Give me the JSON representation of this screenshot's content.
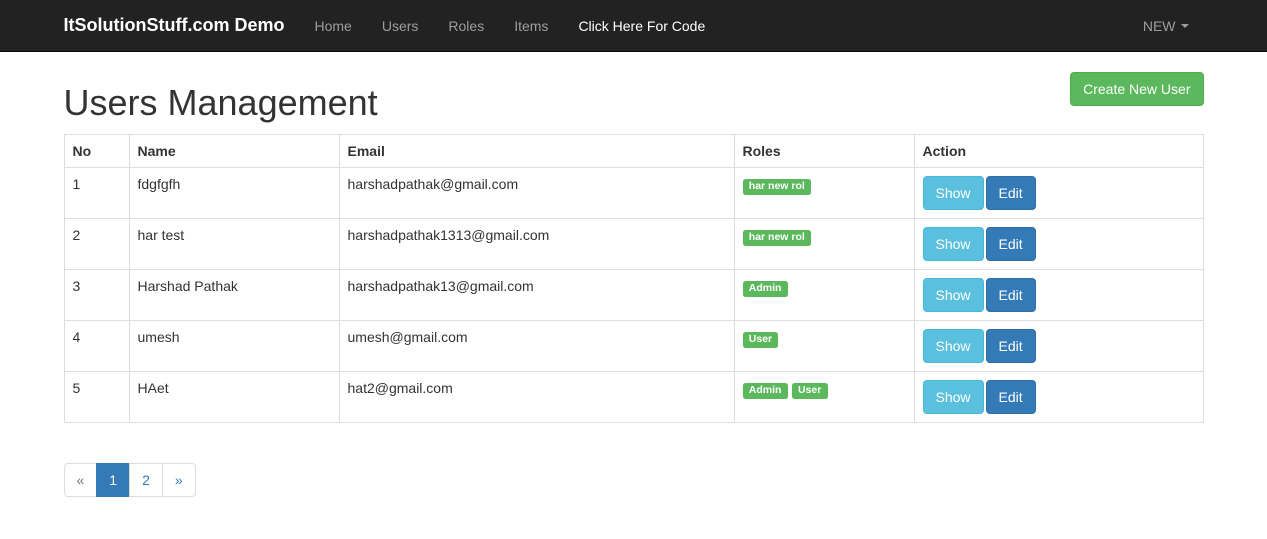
{
  "navbar": {
    "brand": "ItSolutionStuff.com Demo",
    "links": [
      {
        "label": "Home",
        "active": false
      },
      {
        "label": "Users",
        "active": false
      },
      {
        "label": "Roles",
        "active": false
      },
      {
        "label": "Items",
        "active": false
      },
      {
        "label": "Click Here For Code",
        "active": true
      }
    ],
    "right_label": "NEW"
  },
  "page": {
    "title": "Users Management",
    "create_button": "Create New User"
  },
  "table": {
    "headers": {
      "no": "No",
      "name": "Name",
      "email": "Email",
      "roles": "Roles",
      "action": "Action"
    },
    "rows": [
      {
        "no": "1",
        "name": "fdgfgfh",
        "email": "harshadpathak@gmail.com",
        "roles": [
          "har new rol"
        ]
      },
      {
        "no": "2",
        "name": "har test",
        "email": "harshadpathak1313@gmail.com",
        "roles": [
          "har new rol"
        ]
      },
      {
        "no": "3",
        "name": "Harshad Pathak",
        "email": "harshadpathak13@gmail.com",
        "roles": [
          "Admin"
        ]
      },
      {
        "no": "4",
        "name": "umesh",
        "email": "umesh@gmail.com",
        "roles": [
          "User"
        ]
      },
      {
        "no": "5",
        "name": "HAet",
        "email": "hat2@gmail.com",
        "roles": [
          "Admin",
          "User"
        ]
      }
    ],
    "actions": {
      "show": "Show",
      "edit": "Edit"
    }
  },
  "pagination": {
    "prev": "«",
    "pages": [
      "1",
      "2"
    ],
    "active": "1",
    "next": "»"
  }
}
